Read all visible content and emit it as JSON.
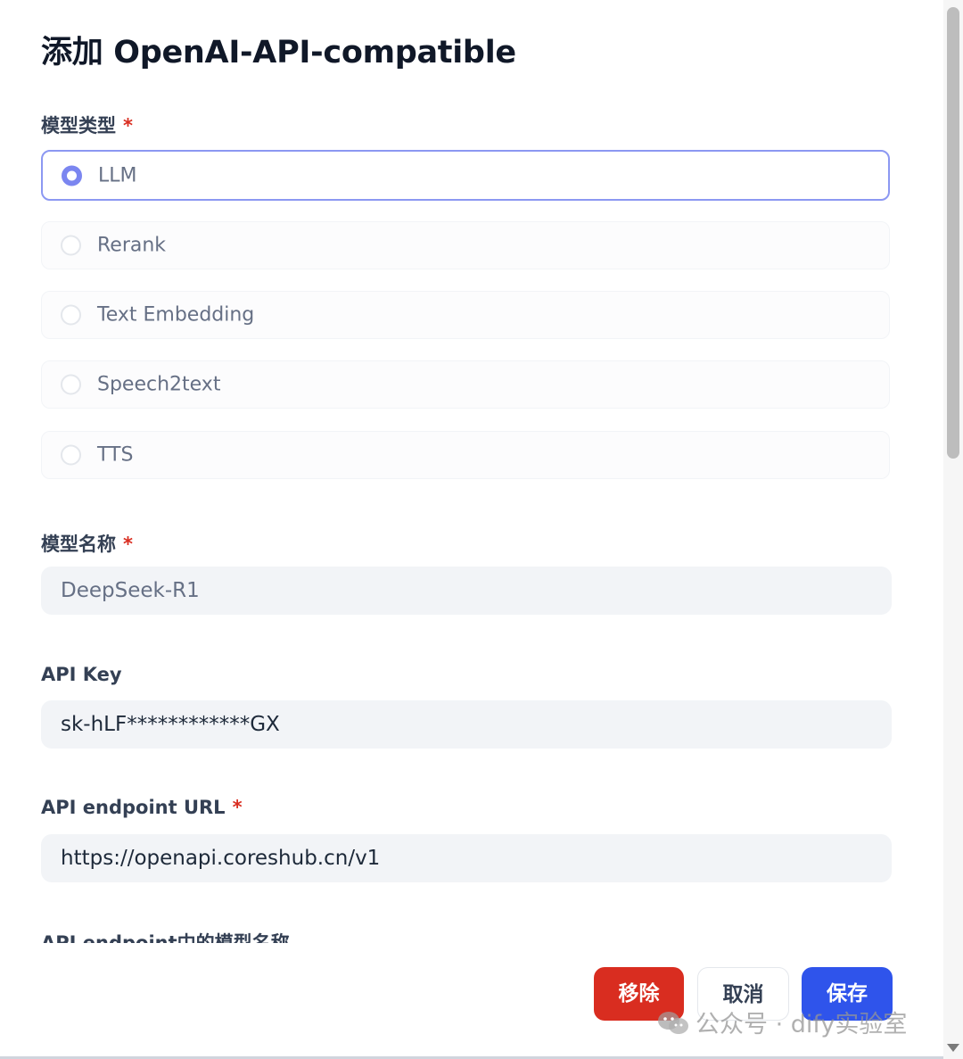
{
  "dialog": {
    "title": "添加 OpenAI-API-compatible"
  },
  "model_type": {
    "label": "模型类型",
    "required_mark": "*",
    "options": [
      {
        "label": "LLM",
        "selected": true
      },
      {
        "label": "Rerank",
        "selected": false
      },
      {
        "label": "Text Embedding",
        "selected": false
      },
      {
        "label": "Speech2text",
        "selected": false
      },
      {
        "label": "TTS",
        "selected": false
      }
    ]
  },
  "model_name": {
    "label": "模型名称",
    "required_mark": "*",
    "value": "DeepSeek-R1"
  },
  "api_key": {
    "label": "API Key",
    "value": "sk-hLF************GX"
  },
  "endpoint_url": {
    "label": "API endpoint URL",
    "required_mark": "*",
    "value": "https://openapi.coreshub.cn/v1"
  },
  "endpoint_model_name": {
    "label": "API endpoint中的模型名称"
  },
  "buttons": {
    "remove": "移除",
    "cancel": "取消",
    "save": "保存"
  },
  "watermark": {
    "text": "公众号 · dify实验室"
  },
  "colors": {
    "accent": "#2f54eb",
    "danger": "#d92d20",
    "selected_border": "#8c98f2",
    "field_bg": "#f2f4f7"
  }
}
